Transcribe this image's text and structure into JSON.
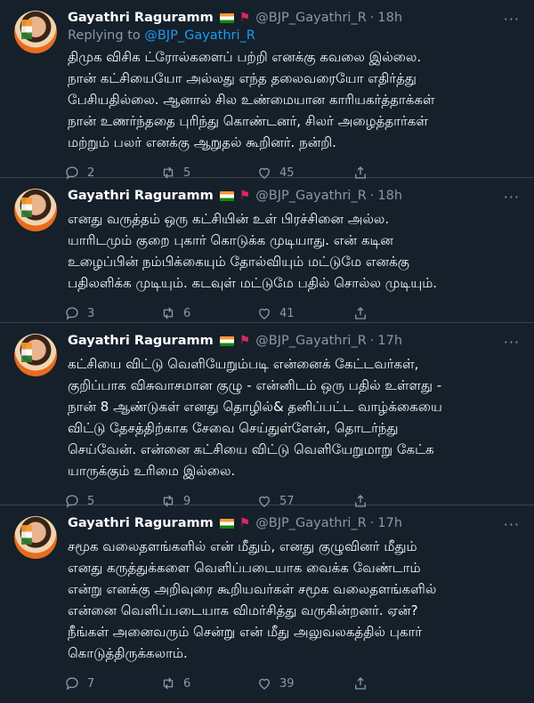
{
  "tweets": [
    {
      "name": "Gayathri Raguramm",
      "handle": "@BJP_Gayathri_R",
      "time": "18h",
      "reply_prefix": "Replying to",
      "reply_handle": "@BJP_Gayathri_R",
      "text": "திமுக விசிக ட்ரோல்களைப் பற்றி எனக்கு கவலை இல்லை.\nநான் கட்சியையோ அல்லது எந்த தலைவரையோ எதிர்த்து\nபேசியதில்லை. ஆனால் சில உண்மையான காரியகர்த்தாக்கள்\nநான் உணர்ந்ததை புரிந்து கொண்டனர், சிலர் அழைத்தார்கள்\nமற்றும் பலர் எனக்கு ஆறுதல் கூறினர்.  நன்றி.",
      "replies": "2",
      "retweets": "5",
      "likes": "45"
    },
    {
      "name": "Gayathri Raguramm",
      "handle": "@BJP_Gayathri_R",
      "time": "18h",
      "text": "எனது வருத்தம் ஒரு கட்சியின் உள் பிரச்சினை அல்ல.\nயாரிடமும் குறை புகார் கொடுக்க முடியாது. என் கடின\nஉழைப்பின் நம்பிக்கையும் தோல்வியும் மட்டுமே எனக்கு\nபதிலளிக்க முடியும். கடவுள் மட்டுமே பதில் சொல்ல முடியும்.",
      "replies": "3",
      "retweets": "6",
      "likes": "41"
    },
    {
      "name": "Gayathri Raguramm",
      "handle": "@BJP_Gayathri_R",
      "time": "17h",
      "text": "கட்சியை விட்டு வெளியேறும்படி என்னைக் கேட்டவர்கள்,\nகுறிப்பாக விசுவாசமான குழு - என்னிடம் ஒரு பதில் உள்ளது -\nநான் 8 ஆண்டுகள் எனது தொழில்& தனிப்பட்ட வாழ்க்கையை\nவிட்டு தேசத்திற்காக சேவை செய்துள்ளேன், தொடர்ந்து\nசெய்வேன். என்னை கட்சியை விட்டு வெளியேறுமாறு கேட்க\nயாருக்கும் உரிமை இல்லை.",
      "replies": "5",
      "retweets": "9",
      "likes": "57"
    },
    {
      "name": "Gayathri Raguramm",
      "handle": "@BJP_Gayathri_R",
      "time": "17h",
      "text": "சமூக வலைதளங்களில் என் மீதும், எனது குழுவினர் மீதும்\nஎனது கருத்துக்களை வெளிப்படையாக வைக்க வேண்டாம்\nஎன்று எனக்கு அறிவுரை கூறியவர்கள் சமூக வலைதளங்களில்\nஎன்னை வெளிப்படையாக விமர்சித்து வருகின்றனர். ஏன்?\nநீங்கள் அனைவரும் சென்று என் மீது அலுவலகத்தில் புகார்\nகொடுத்திருக்கலாம்.",
      "replies": "7",
      "retweets": "6",
      "likes": "39"
    }
  ],
  "icons": {
    "reply": "reply-icon",
    "retweet": "retweet-icon",
    "like": "like-icon",
    "share": "share-icon",
    "more": "more-icon"
  },
  "colors": {
    "background": "#15202b",
    "link": "#1d9bf0",
    "muted": "#8b98a5",
    "divider": "#38444d"
  }
}
